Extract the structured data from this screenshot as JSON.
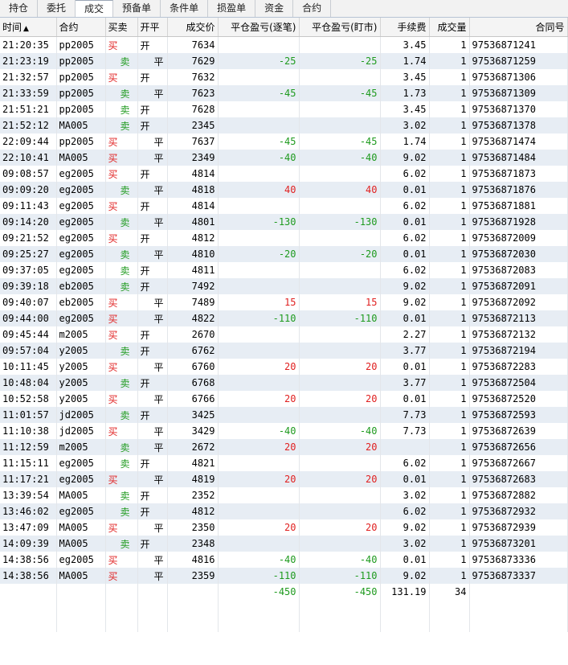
{
  "tabs": [
    "持仓",
    "委托",
    "成交",
    "预备单",
    "条件单",
    "损盈单",
    "资金",
    "合约"
  ],
  "active_tab": 2,
  "columns": {
    "time": "时间",
    "contract": "合约",
    "side": "买卖",
    "open_close": "开平",
    "price": "成交价",
    "pnl_trade": "平仓盈亏(逐笔)",
    "pnl_mark": "平仓盈亏(盯市)",
    "fee": "手续费",
    "qty": "成交量",
    "order_no": "合同号"
  },
  "sort_indicator": "▲",
  "rows": [
    {
      "time": "21:20:35",
      "contract": "pp2005",
      "side": "买",
      "open_close": "开",
      "price": "7634",
      "pnl_trade": "",
      "pnl_mark": "",
      "fee": "3.45",
      "qty": "1",
      "order_no": "97536871241"
    },
    {
      "time": "21:23:19",
      "contract": "pp2005",
      "side": "卖",
      "open_close": "平",
      "price": "7629",
      "pnl_trade": "-25",
      "pnl_mark": "-25",
      "fee": "1.74",
      "qty": "1",
      "order_no": "97536871259"
    },
    {
      "time": "21:32:57",
      "contract": "pp2005",
      "side": "买",
      "open_close": "开",
      "price": "7632",
      "pnl_trade": "",
      "pnl_mark": "",
      "fee": "3.45",
      "qty": "1",
      "order_no": "97536871306"
    },
    {
      "time": "21:33:59",
      "contract": "pp2005",
      "side": "卖",
      "open_close": "平",
      "price": "7623",
      "pnl_trade": "-45",
      "pnl_mark": "-45",
      "fee": "1.73",
      "qty": "1",
      "order_no": "97536871309"
    },
    {
      "time": "21:51:21",
      "contract": "pp2005",
      "side": "卖",
      "open_close": "开",
      "price": "7628",
      "pnl_trade": "",
      "pnl_mark": "",
      "fee": "3.45",
      "qty": "1",
      "order_no": "97536871370"
    },
    {
      "time": "21:52:12",
      "contract": "MA005",
      "side": "卖",
      "open_close": "开",
      "price": "2345",
      "pnl_trade": "",
      "pnl_mark": "",
      "fee": "3.02",
      "qty": "1",
      "order_no": "97536871378"
    },
    {
      "time": "22:09:44",
      "contract": "pp2005",
      "side": "买",
      "open_close": "平",
      "price": "7637",
      "pnl_trade": "-45",
      "pnl_mark": "-45",
      "fee": "1.74",
      "qty": "1",
      "order_no": "97536871474"
    },
    {
      "time": "22:10:41",
      "contract": "MA005",
      "side": "买",
      "open_close": "平",
      "price": "2349",
      "pnl_trade": "-40",
      "pnl_mark": "-40",
      "fee": "9.02",
      "qty": "1",
      "order_no": "97536871484"
    },
    {
      "time": "09:08:57",
      "contract": "eg2005",
      "side": "买",
      "open_close": "开",
      "price": "4814",
      "pnl_trade": "",
      "pnl_mark": "",
      "fee": "6.02",
      "qty": "1",
      "order_no": "97536871873"
    },
    {
      "time": "09:09:20",
      "contract": "eg2005",
      "side": "卖",
      "open_close": "平",
      "price": "4818",
      "pnl_trade": "40",
      "pnl_mark": "40",
      "fee": "0.01",
      "qty": "1",
      "order_no": "97536871876"
    },
    {
      "time": "09:11:43",
      "contract": "eg2005",
      "side": "买",
      "open_close": "开",
      "price": "4814",
      "pnl_trade": "",
      "pnl_mark": "",
      "fee": "6.02",
      "qty": "1",
      "order_no": "97536871881"
    },
    {
      "time": "09:14:20",
      "contract": "eg2005",
      "side": "卖",
      "open_close": "平",
      "price": "4801",
      "pnl_trade": "-130",
      "pnl_mark": "-130",
      "fee": "0.01",
      "qty": "1",
      "order_no": "97536871928"
    },
    {
      "time": "09:21:52",
      "contract": "eg2005",
      "side": "买",
      "open_close": "开",
      "price": "4812",
      "pnl_trade": "",
      "pnl_mark": "",
      "fee": "6.02",
      "qty": "1",
      "order_no": "97536872009"
    },
    {
      "time": "09:25:27",
      "contract": "eg2005",
      "side": "卖",
      "open_close": "平",
      "price": "4810",
      "pnl_trade": "-20",
      "pnl_mark": "-20",
      "fee": "0.01",
      "qty": "1",
      "order_no": "97536872030"
    },
    {
      "time": "09:37:05",
      "contract": "eg2005",
      "side": "卖",
      "open_close": "开",
      "price": "4811",
      "pnl_trade": "",
      "pnl_mark": "",
      "fee": "6.02",
      "qty": "1",
      "order_no": "97536872083"
    },
    {
      "time": "09:39:18",
      "contract": "eb2005",
      "side": "卖",
      "open_close": "开",
      "price": "7492",
      "pnl_trade": "",
      "pnl_mark": "",
      "fee": "9.02",
      "qty": "1",
      "order_no": "97536872091"
    },
    {
      "time": "09:40:07",
      "contract": "eb2005",
      "side": "买",
      "open_close": "平",
      "price": "7489",
      "pnl_trade": "15",
      "pnl_mark": "15",
      "fee": "9.02",
      "qty": "1",
      "order_no": "97536872092"
    },
    {
      "time": "09:44:00",
      "contract": "eg2005",
      "side": "买",
      "open_close": "平",
      "price": "4822",
      "pnl_trade": "-110",
      "pnl_mark": "-110",
      "fee": "0.01",
      "qty": "1",
      "order_no": "97536872113"
    },
    {
      "time": "09:45:44",
      "contract": "m2005",
      "side": "买",
      "open_close": "开",
      "price": "2670",
      "pnl_trade": "",
      "pnl_mark": "",
      "fee": "2.27",
      "qty": "1",
      "order_no": "97536872132"
    },
    {
      "time": "09:57:04",
      "contract": "y2005",
      "side": "卖",
      "open_close": "开",
      "price": "6762",
      "pnl_trade": "",
      "pnl_mark": "",
      "fee": "3.77",
      "qty": "1",
      "order_no": "97536872194"
    },
    {
      "time": "10:11:45",
      "contract": "y2005",
      "side": "买",
      "open_close": "平",
      "price": "6760",
      "pnl_trade": "20",
      "pnl_mark": "20",
      "fee": "0.01",
      "qty": "1",
      "order_no": "97536872283"
    },
    {
      "time": "10:48:04",
      "contract": "y2005",
      "side": "卖",
      "open_close": "开",
      "price": "6768",
      "pnl_trade": "",
      "pnl_mark": "",
      "fee": "3.77",
      "qty": "1",
      "order_no": "97536872504"
    },
    {
      "time": "10:52:58",
      "contract": "y2005",
      "side": "买",
      "open_close": "平",
      "price": "6766",
      "pnl_trade": "20",
      "pnl_mark": "20",
      "fee": "0.01",
      "qty": "1",
      "order_no": "97536872520"
    },
    {
      "time": "11:01:57",
      "contract": "jd2005",
      "side": "卖",
      "open_close": "开",
      "price": "3425",
      "pnl_trade": "",
      "pnl_mark": "",
      "fee": "7.73",
      "qty": "1",
      "order_no": "97536872593"
    },
    {
      "time": "11:10:38",
      "contract": "jd2005",
      "side": "买",
      "open_close": "平",
      "price": "3429",
      "pnl_trade": "-40",
      "pnl_mark": "-40",
      "fee": "7.73",
      "qty": "1",
      "order_no": "97536872639"
    },
    {
      "time": "11:12:59",
      "contract": "m2005",
      "side": "卖",
      "open_close": "平",
      "price": "2672",
      "pnl_trade": "20",
      "pnl_mark": "20",
      "fee": "",
      "qty": "1",
      "order_no": "97536872656"
    },
    {
      "time": "11:15:11",
      "contract": "eg2005",
      "side": "卖",
      "open_close": "开",
      "price": "4821",
      "pnl_trade": "",
      "pnl_mark": "",
      "fee": "6.02",
      "qty": "1",
      "order_no": "97536872667"
    },
    {
      "time": "11:17:21",
      "contract": "eg2005",
      "side": "买",
      "open_close": "平",
      "price": "4819",
      "pnl_trade": "20",
      "pnl_mark": "20",
      "fee": "0.01",
      "qty": "1",
      "order_no": "97536872683"
    },
    {
      "time": "13:39:54",
      "contract": "MA005",
      "side": "卖",
      "open_close": "开",
      "price": "2352",
      "pnl_trade": "",
      "pnl_mark": "",
      "fee": "3.02",
      "qty": "1",
      "order_no": "97536872882"
    },
    {
      "time": "13:46:02",
      "contract": "eg2005",
      "side": "卖",
      "open_close": "开",
      "price": "4812",
      "pnl_trade": "",
      "pnl_mark": "",
      "fee": "6.02",
      "qty": "1",
      "order_no": "97536872932"
    },
    {
      "time": "13:47:09",
      "contract": "MA005",
      "side": "买",
      "open_close": "平",
      "price": "2350",
      "pnl_trade": "20",
      "pnl_mark": "20",
      "fee": "9.02",
      "qty": "1",
      "order_no": "97536872939"
    },
    {
      "time": "14:09:39",
      "contract": "MA005",
      "side": "卖",
      "open_close": "开",
      "price": "2348",
      "pnl_trade": "",
      "pnl_mark": "",
      "fee": "3.02",
      "qty": "1",
      "order_no": "97536873201"
    },
    {
      "time": "14:38:56",
      "contract": "eg2005",
      "side": "买",
      "open_close": "平",
      "price": "4816",
      "pnl_trade": "-40",
      "pnl_mark": "-40",
      "fee": "0.01",
      "qty": "1",
      "order_no": "97536873336"
    },
    {
      "time": "14:38:56",
      "contract": "MA005",
      "side": "买",
      "open_close": "平",
      "price": "2359",
      "pnl_trade": "-110",
      "pnl_mark": "-110",
      "fee": "9.02",
      "qty": "1",
      "order_no": "97536873337"
    }
  ],
  "totals": {
    "pnl_trade": "-450",
    "pnl_mark": "-450",
    "fee": "131.19",
    "qty": "34"
  },
  "empty_rows": 2,
  "colors": {
    "buy": "#e02020",
    "sell": "#1e9a1e",
    "profit": "#e02020",
    "loss": "#1e9a1e",
    "row_alt": "#e7edf4"
  }
}
